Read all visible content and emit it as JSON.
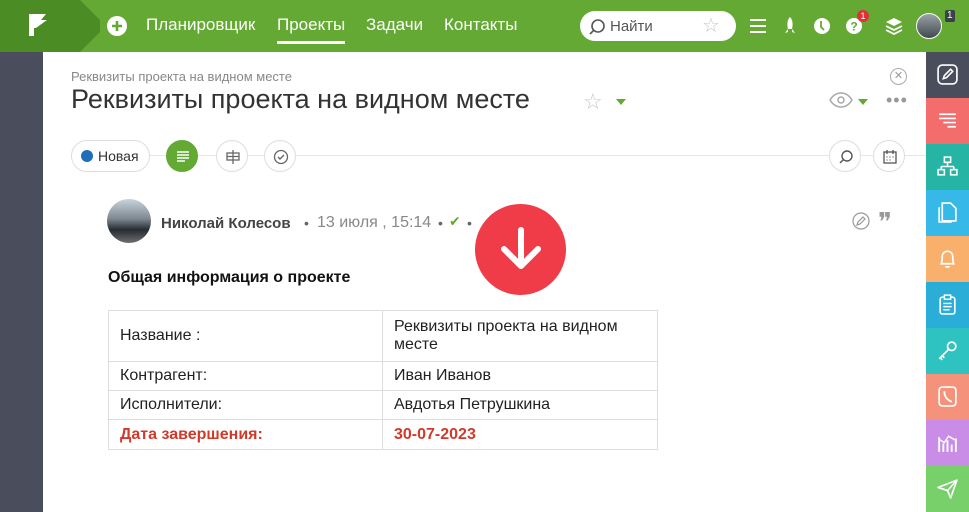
{
  "topbar": {
    "nav": [
      "Планировщик",
      "Проекты",
      "Задачи",
      "Контакты"
    ],
    "active_nav": "Проекты",
    "search_placeholder": "Найти",
    "help_badge": "1",
    "avatar_badge": "1"
  },
  "page": {
    "breadcrumb": "Реквизиты проекта на видном месте",
    "title": "Реквизиты проекта на видном месте",
    "status": "Новая"
  },
  "post": {
    "author": "Николай Колесов",
    "posted": "13 июля , 15:14",
    "section_title": "Общая информация о проекте",
    "rows": [
      {
        "label": "Название :",
        "value": "Реквизиты проекта на видном месте"
      },
      {
        "label": "Контрагент:",
        "value": "Иван Иванов"
      },
      {
        "label": "Исполнители:",
        "value": "Авдотья Петрушкина"
      },
      {
        "label": "Дата завершения:",
        "value": "30-07-2023"
      }
    ]
  },
  "icons": {
    "topbar": [
      "menu-icon",
      "rocket-icon",
      "clock-icon",
      "help-icon",
      "layers-icon"
    ],
    "rail": [
      "pen-icon",
      "list-icon",
      "structure-icon",
      "files-icon",
      "bell-icon",
      "clipboard-icon",
      "key-icon",
      "phone-icon",
      "chart-icon",
      "send-icon"
    ]
  },
  "colors": {
    "brand_green": "#64a934",
    "accent_red": "#f03c48",
    "status_blue": "#1e6fb8",
    "rail": [
      "#4a4e5c",
      "#f46d6d",
      "#26b5a5",
      "#36b8e8",
      "#f8b06c",
      "#2aaed8",
      "#2ec2c0",
      "#f4927c",
      "#c98de8",
      "#78d06a"
    ]
  }
}
